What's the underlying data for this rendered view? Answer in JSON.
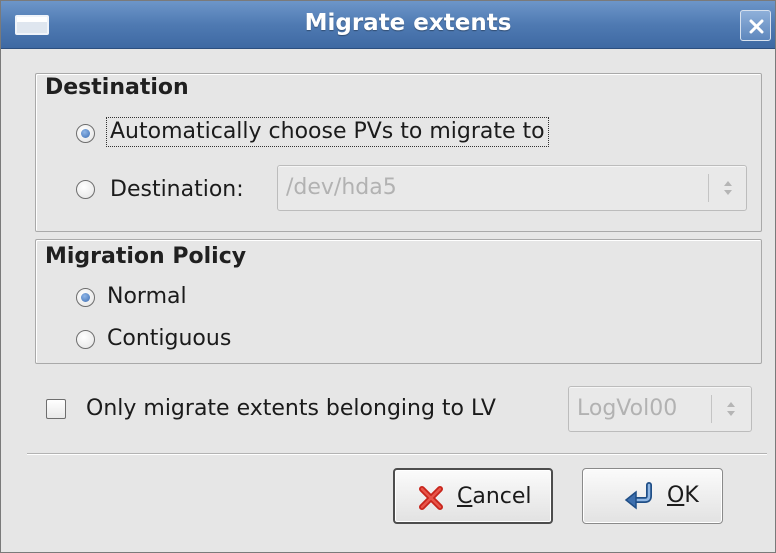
{
  "window": {
    "title": "Migrate extents",
    "accent_color": "#4f7ab2"
  },
  "destination": {
    "heading": "Destination",
    "auto_option_label": "Automatically choose PVs to migrate to",
    "auto_option_selected": true,
    "dest_option_label": "Destination:",
    "dest_option_selected": false,
    "dest_combo_value": "/dev/hda5"
  },
  "policy": {
    "heading": "Migration Policy",
    "options": [
      {
        "label": "Normal",
        "selected": true
      },
      {
        "label": "Contiguous",
        "selected": false
      }
    ]
  },
  "lv_filter": {
    "checkbox_label": "Only migrate extents belonging to LV",
    "checked": false,
    "combo_value": "LogVol00"
  },
  "buttons": {
    "cancel": {
      "mnemonic": "C",
      "rest": "ancel",
      "icon": "cancel-x-icon"
    },
    "ok": {
      "mnemonic": "O",
      "rest": "K",
      "icon": "ok-return-arrow-icon"
    }
  }
}
